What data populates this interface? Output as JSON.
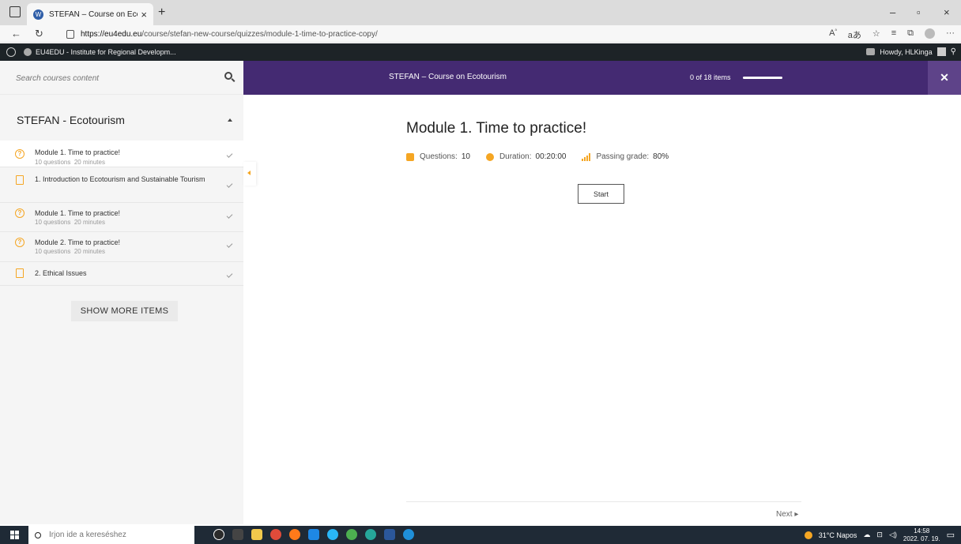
{
  "browser": {
    "tab_title": "STEFAN – Course on Ecotourism",
    "new_tab": "+",
    "url_host": "https://eu4edu.eu",
    "url_path": "/course/stefan-new-course/quizzes/module-1-time-to-practice-copy/"
  },
  "adminbar": {
    "site_name": "EU4EDU - Institute for Regional Developm...",
    "user": "Howdy, HLKinga"
  },
  "sidebar": {
    "search_placeholder": "Search courses content",
    "section_title": "STEFAN - Ecotourism",
    "items": [
      {
        "type": "quiz",
        "name": "Module 1. Time to practice!",
        "questions": "10 questions",
        "duration": "20 minutes"
      },
      {
        "type": "lesson",
        "name": "1. Introduction to Ecotourism and Sustainable Tourism"
      },
      {
        "type": "quiz",
        "name": "Module 1. Time to practice!",
        "questions": "10 questions",
        "duration": "20 minutes"
      },
      {
        "type": "quiz",
        "name": "Module 2. Time to practice!",
        "questions": "10 questions",
        "duration": "20 minutes"
      },
      {
        "type": "lesson",
        "name": "2. Ethical Issues"
      }
    ],
    "show_more": "SHOW MORE ITEMS"
  },
  "header": {
    "course_title": "STEFAN – Course on Ecotourism",
    "progress_text": "0 of 18 items",
    "progress_value": 0,
    "close": "✕"
  },
  "quiz": {
    "title": "Module 1. Time to practice!",
    "questions_label": "Questions:",
    "questions_value": "10",
    "duration_label": "Duration:",
    "duration_value": "00:20:00",
    "passing_label": "Passing grade:",
    "passing_value": "80%",
    "start": "Start",
    "next": "Next ▸"
  },
  "taskbar": {
    "search_placeholder": "Írjon ide a kereséshez",
    "weather": "31°C  Napos",
    "time": "14:58",
    "date": "2022. 07. 19."
  },
  "colors": {
    "header_bg": "#442a72",
    "accent": "#f5a623"
  }
}
